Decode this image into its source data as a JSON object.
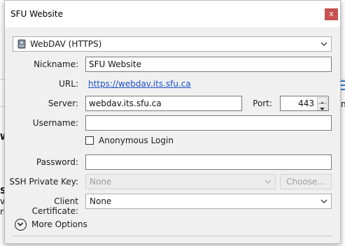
{
  "window": {
    "title": "SFU Website",
    "close_label": "x"
  },
  "protocol": {
    "value": "WebDAV (HTTPS)"
  },
  "fields": {
    "nickname": {
      "label": "Nickname:",
      "value": "SFU Website"
    },
    "url": {
      "label": "URL:",
      "value": "https://webdav.its.sfu.ca"
    },
    "server": {
      "label": "Server:",
      "value": "webdav.its.sfu.ca"
    },
    "port": {
      "label": "Port:",
      "value": "443"
    },
    "username": {
      "label": "Username:",
      "value": ""
    },
    "anonymous": {
      "label": "Anonymous Login",
      "checked": false
    },
    "password": {
      "label": "Password:",
      "value": ""
    },
    "ssh_key": {
      "label": "SSH Private Key:",
      "value": "None",
      "button": "Choose..."
    },
    "client_cert": {
      "label": "Client Certificate:",
      "value": "None"
    }
  },
  "more_options": {
    "label": "More Options"
  },
  "background": {
    "fragments": [
      "W",
      "SF",
      "ve",
      "rh",
      "n"
    ]
  },
  "colors": {
    "close": "#c75050",
    "link": "#1a50c9"
  }
}
